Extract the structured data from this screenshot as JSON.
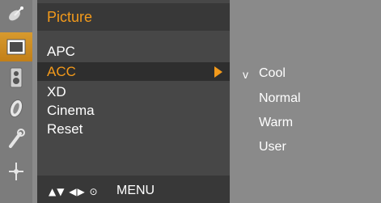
{
  "sidebar": {
    "icons": [
      {
        "name": "satellite-dish-icon",
        "selected": false
      },
      {
        "name": "picture-icon",
        "selected": true
      },
      {
        "name": "speaker-icon",
        "selected": false
      },
      {
        "name": "timer-icon",
        "selected": false
      },
      {
        "name": "wrench-icon",
        "selected": false
      },
      {
        "name": "pip-icon",
        "selected": false
      }
    ]
  },
  "menu": {
    "title": "Picture",
    "items": [
      {
        "label": "APC",
        "selected": false
      },
      {
        "label": "ACC",
        "selected": true
      },
      {
        "label": "XD",
        "selected": false
      },
      {
        "label": "Cinema",
        "selected": false
      },
      {
        "label": "Reset",
        "selected": false
      }
    ]
  },
  "submenu": {
    "check_mark": "v",
    "options": [
      "Cool",
      "Normal",
      "Warm",
      "User"
    ],
    "checked": "Cool"
  },
  "nav": {
    "glyphs": "▲▼ ◀▶ ⊙",
    "label": "MENU"
  },
  "colors": {
    "accent": "#f39a1b",
    "panel": "#474747",
    "background": "#8a8a8a"
  }
}
